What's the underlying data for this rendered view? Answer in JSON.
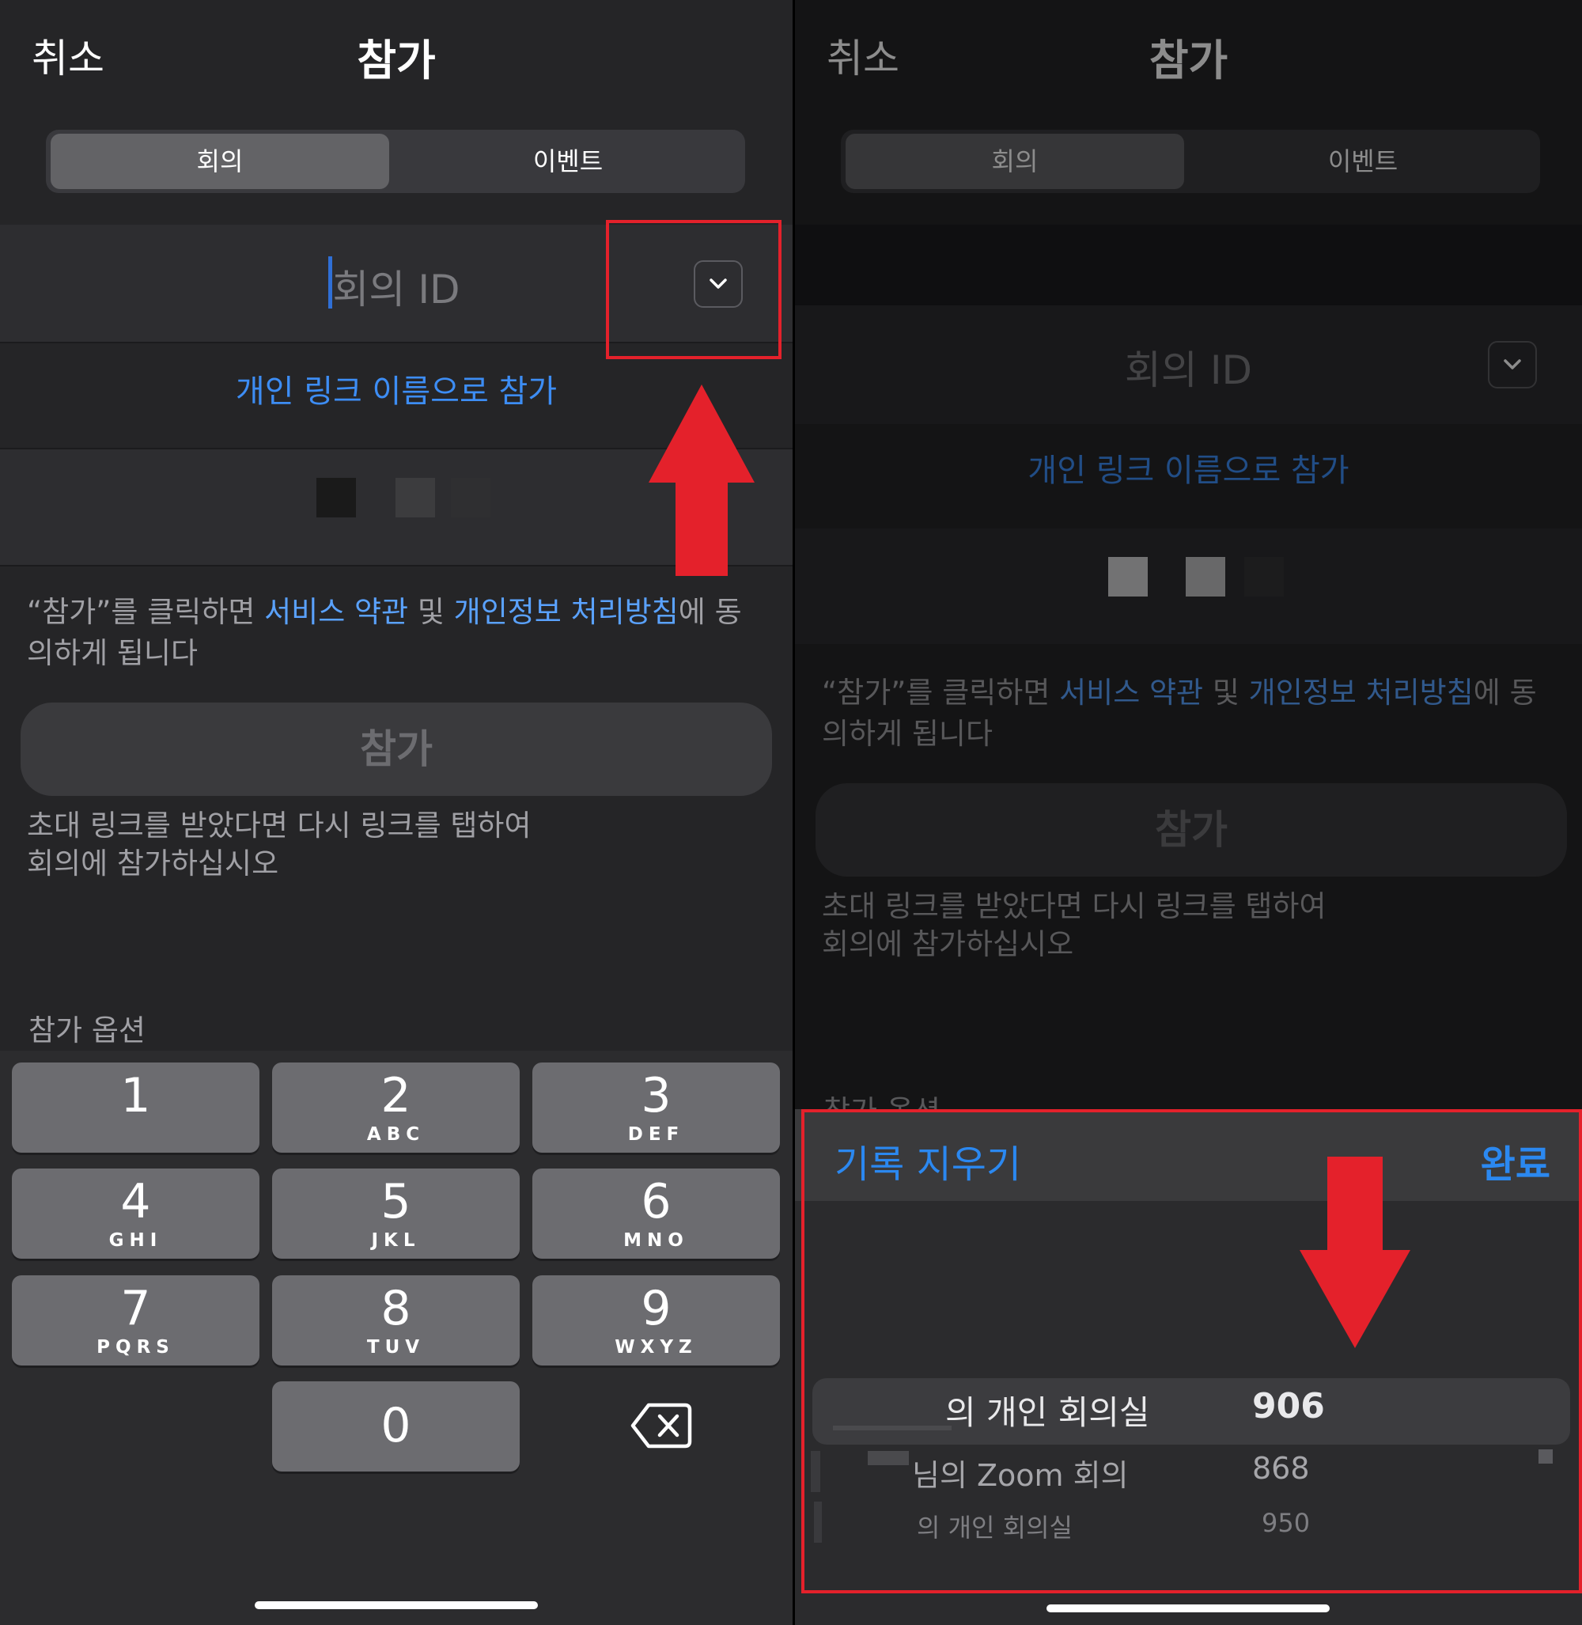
{
  "header": {
    "cancel": "취소",
    "title": "참가"
  },
  "segment": {
    "meeting": "회의",
    "event": "이벤트"
  },
  "meeting_id": {
    "placeholder": "회의 ID"
  },
  "personal_link": "개인 링크 이름으로 참가",
  "terms": {
    "prefix": "“참가”를 클릭하면 ",
    "service_terms": "서비스 약관",
    "and": " 및 ",
    "privacy": "개인정보 처리방침",
    "suffix": "에 동의하게 됩니다"
  },
  "join_button": "참가",
  "hint": {
    "line1": "초대 링크를 받았다면 다시 링크를 탭하여",
    "line2": "회의에 참가하십시오"
  },
  "join_options": "참가 옵션",
  "keypad": [
    {
      "digit": "1",
      "letters": ""
    },
    {
      "digit": "2",
      "letters": "ABC"
    },
    {
      "digit": "3",
      "letters": "DEF"
    },
    {
      "digit": "4",
      "letters": "GHI"
    },
    {
      "digit": "5",
      "letters": "JKL"
    },
    {
      "digit": "6",
      "letters": "MNO"
    },
    {
      "digit": "7",
      "letters": "PQRS"
    },
    {
      "digit": "8",
      "letters": "TUV"
    },
    {
      "digit": "9",
      "letters": "WXYZ"
    },
    {
      "digit": "0",
      "letters": ""
    }
  ],
  "history_sheet": {
    "clear": "기록 지우기",
    "done": "완료",
    "items": [
      {
        "name": "의 개인 회의실",
        "number": "906"
      },
      {
        "name": "님의 Zoom 회의",
        "number": "868"
      },
      {
        "name": "의 개인 회의실",
        "number": "950"
      }
    ]
  },
  "colors": {
    "accent": "#3d8df4",
    "annotation": "#e4212b",
    "background": "#252527"
  }
}
